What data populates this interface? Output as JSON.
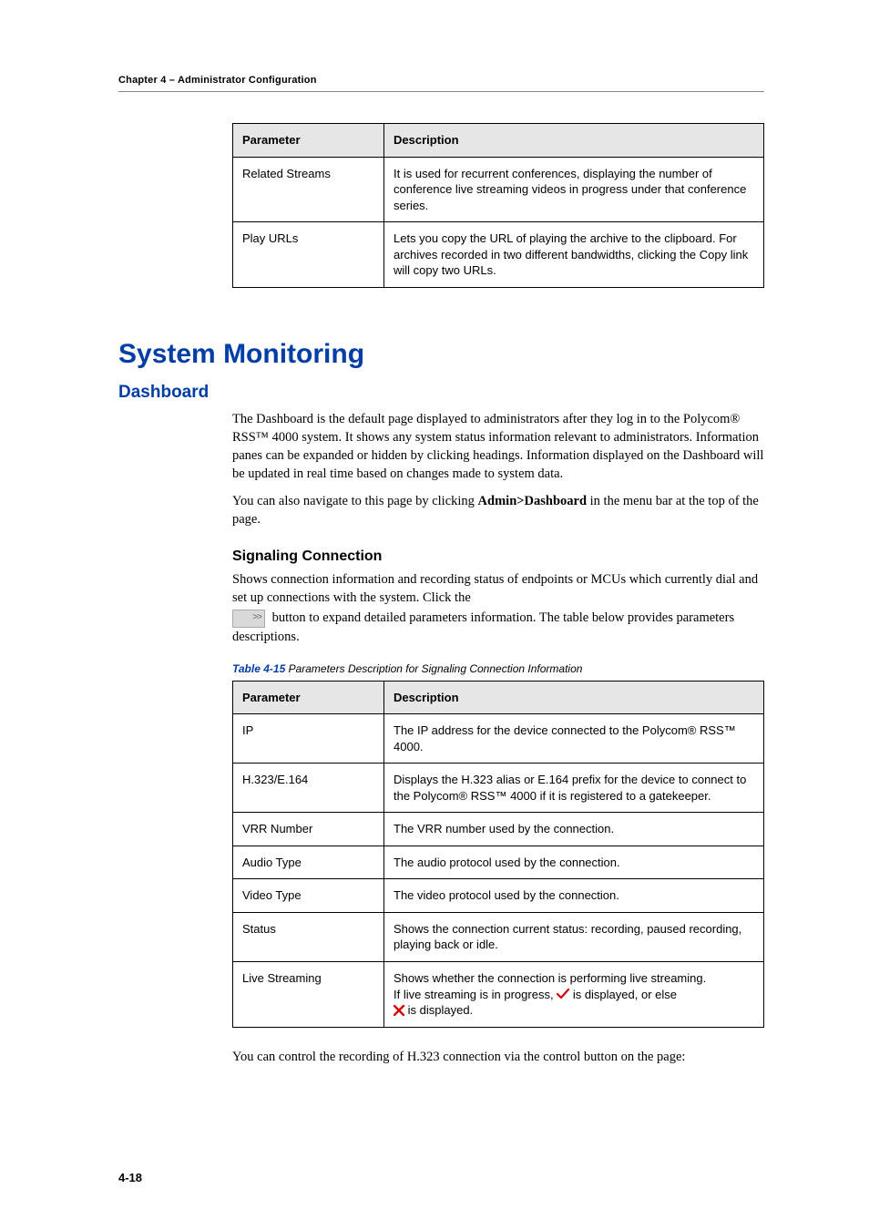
{
  "header": {
    "chapter_line": "Chapter 4 – Administrator Configuration"
  },
  "table1": {
    "headers": {
      "param": "Parameter",
      "desc": "Description"
    },
    "rows": [
      {
        "param": "Related Streams",
        "desc": "It is used for recurrent conferences, displaying the number of conference live streaming videos in progress under that conference series."
      },
      {
        "param": "Play URLs",
        "desc": "Lets you copy the URL of playing the archive to the clipboard. For archives recorded in two different bandwidths, clicking the Copy link will copy two URLs."
      }
    ]
  },
  "section": {
    "h1": "System Monitoring",
    "h2": "Dashboard",
    "p1": "The Dashboard is the default page displayed to administrators after they log in to the Polycom® RSS™ 4000 system. It shows any system status information relevant to administrators. Information panes can be expanded or hidden by clicking headings. Information displayed on the Dashboard will be updated in real time based on changes made to system data.",
    "p2_a": "You can also navigate to this page by clicking ",
    "p2_b": "Admin>Dashboard",
    "p2_c": " in the menu bar at the top of the page.",
    "h3": "Signaling Connection",
    "p3": "Shows connection information and recording status of endpoints or MCUs which currently dial and set up connections with the system. Click the",
    "p4": " button to expand detailed parameters information. The table below provides parameters descriptions."
  },
  "table2_caption": {
    "strong": "Table 4-15",
    "rest": " Parameters Description for Signaling Connection Information"
  },
  "table2": {
    "headers": {
      "param": "Parameter",
      "desc": "Description"
    },
    "rows": {
      "0": {
        "param": "IP",
        "desc": "The IP address for the device connected to the Polycom® RSS™ 4000."
      },
      "1": {
        "param": "H.323/E.164",
        "desc": "Displays the H.323 alias or E.164 prefix for the device to connect to the Polycom® RSS™ 4000 if it is registered to a gatekeeper."
      },
      "2": {
        "param": "VRR Number",
        "desc": "The VRR number used by the connection."
      },
      "3": {
        "param": "Audio Type",
        "desc": "The audio protocol used by the connection."
      },
      "4": {
        "param": "Video Type",
        "desc": "The video protocol used by the connection."
      },
      "5": {
        "param": "Status",
        "desc": "Shows the connection current status: recording, paused recording, playing back or idle."
      },
      "6": {
        "param": "Live Streaming",
        "line1": "Shows whether the connection is performing live streaming.",
        "line2a": "If live streaming is in progress, ",
        "line2b": " is displayed, or else ",
        "line3": " is displayed."
      }
    }
  },
  "closing_p": "You can control the recording of H.323 connection via the control button on the page:",
  "footer": {
    "page_num": "4-18"
  }
}
